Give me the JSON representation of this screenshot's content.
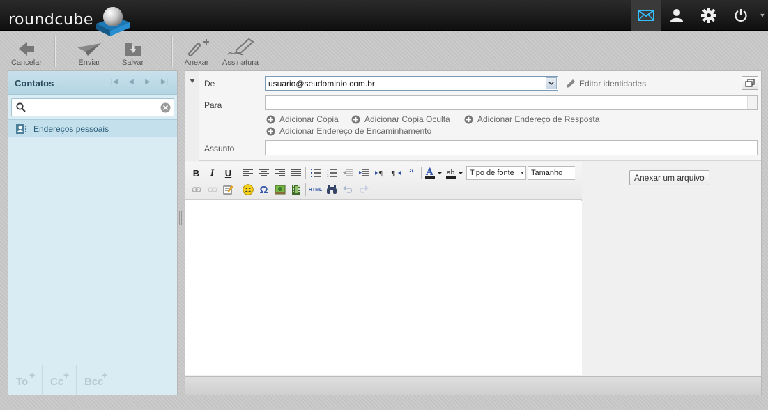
{
  "app": {
    "name": "roundcube"
  },
  "topnav": {
    "items": [
      {
        "icon": "mail-icon",
        "active": true
      },
      {
        "icon": "user-icon",
        "active": false
      },
      {
        "icon": "gear-icon",
        "active": false
      },
      {
        "icon": "power-icon",
        "active": false
      }
    ],
    "accent": "#37beff"
  },
  "toolbar": {
    "cancel_label": "Cancelar",
    "send_label": "Enviar",
    "save_label": "Salvar",
    "attach_label": "Anexar",
    "signature_label": "Assinatura"
  },
  "contacts": {
    "title": "Contatos",
    "search_placeholder": "",
    "groups": [
      {
        "label": "Endereços pessoais",
        "icon": "address-book-icon"
      }
    ],
    "footer_buttons": [
      {
        "label": "To"
      },
      {
        "label": "Cc"
      },
      {
        "label": "Bcc"
      }
    ]
  },
  "compose": {
    "from_label": "De",
    "from_value": "usuario@seudominio.com.br",
    "edit_identities_label": "Editar identidades",
    "to_label": "Para",
    "to_value": "",
    "add_cc_label": "Adicionar Cópia",
    "add_bcc_label": "Adicionar Cópia Oculta",
    "add_replyto_label": "Adicionar Endereço de Resposta",
    "add_followupto_label": "Adicionar Endereço de Encaminhamento",
    "subject_label": "Assunto",
    "subject_value": ""
  },
  "editor": {
    "font_family_label": "Tipo de fonte",
    "font_size_label": "Tamanho",
    "bold_label": "B",
    "italic_label": "I",
    "underline_label": "U",
    "html_label": "HTML",
    "omega_label": "Ω"
  },
  "attachments": {
    "attach_file_label": "Anexar um arquivo"
  }
}
